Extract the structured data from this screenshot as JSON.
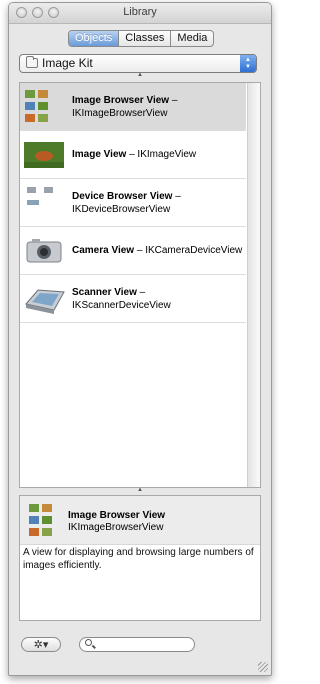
{
  "window": {
    "title": "Library"
  },
  "tabs": [
    {
      "label": "Objects",
      "selected": true
    },
    {
      "label": "Classes",
      "selected": false
    },
    {
      "label": "Media",
      "selected": false
    }
  ],
  "group_popup": {
    "value": "Image Kit"
  },
  "items": [
    {
      "name": "Image Browser View",
      "class": "IKImageBrowserView",
      "icon": "image-browser-view-icon",
      "selected": true
    },
    {
      "name": "Image View",
      "class": "IKImageView",
      "icon": "image-view-icon",
      "selected": false
    },
    {
      "name": "Device Browser View",
      "class": "IKDeviceBrowserView",
      "icon": "device-browser-view-icon",
      "selected": false
    },
    {
      "name": "Camera View",
      "class": "IKCameraDeviceView",
      "icon": "camera-icon",
      "selected": false
    },
    {
      "name": "Scanner View",
      "class": "IKScannerDeviceView",
      "icon": "scanner-icon",
      "selected": false
    }
  ],
  "detail": {
    "name": "Image Browser View",
    "class": "IKImageBrowserView",
    "description": "A view for displaying and browsing large numbers of images efficiently."
  },
  "bottom": {
    "action_menu": "gear-icon",
    "search_placeholder": ""
  },
  "colors": {
    "selection_blue": "#6b9ad9",
    "selected_row": "#dadada"
  }
}
